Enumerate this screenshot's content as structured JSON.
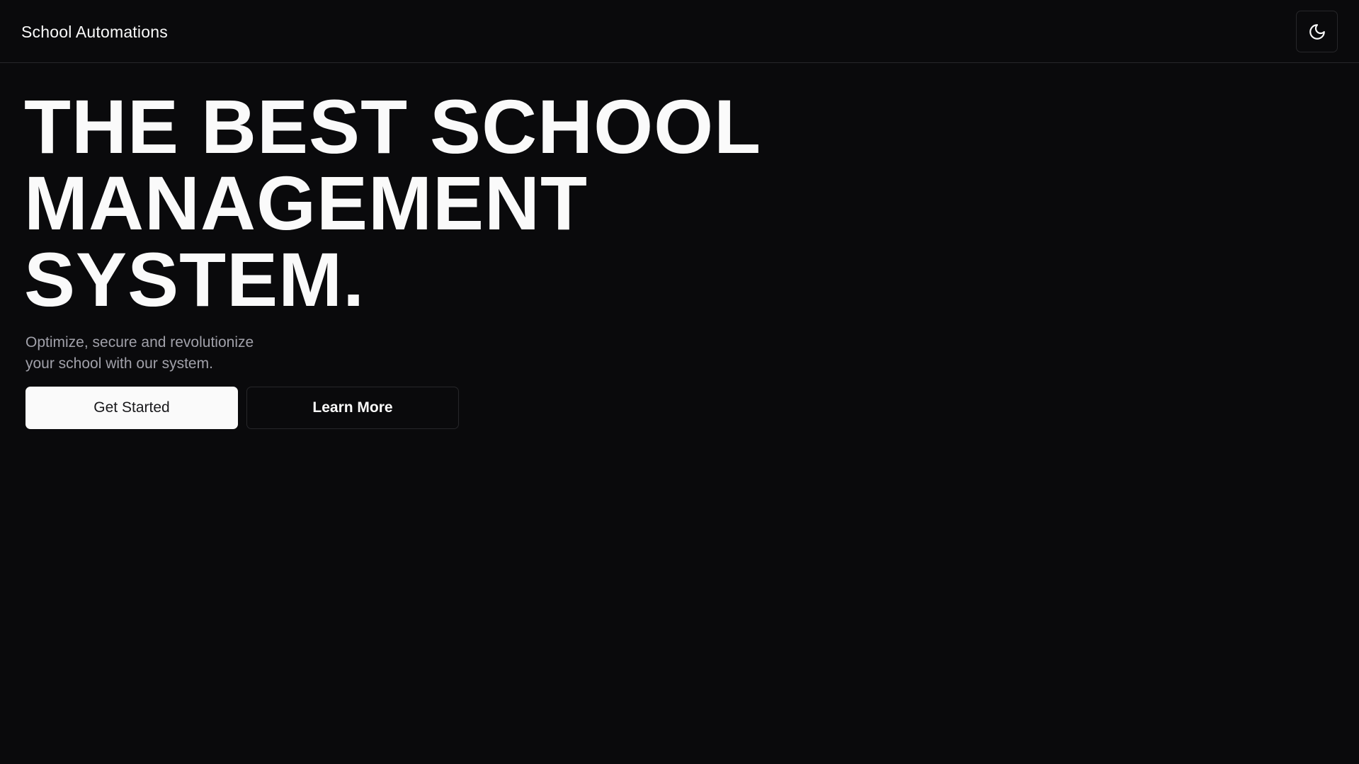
{
  "header": {
    "brand": "School Automations",
    "theme_toggle_icon": "moon-icon"
  },
  "hero": {
    "title_lines": [
      "THE BEST SCHOOL",
      "MANAGEMENT",
      "SYSTEM."
    ],
    "subtitle_lines": [
      "Optimize, secure and revolutionize",
      "your school with our system."
    ],
    "primary_button": "Get Started",
    "secondary_button": "Learn More"
  },
  "colors": {
    "background": "#0a0a0c",
    "foreground": "#fafafa",
    "muted_text": "#a1a1aa",
    "border": "#27272a"
  }
}
